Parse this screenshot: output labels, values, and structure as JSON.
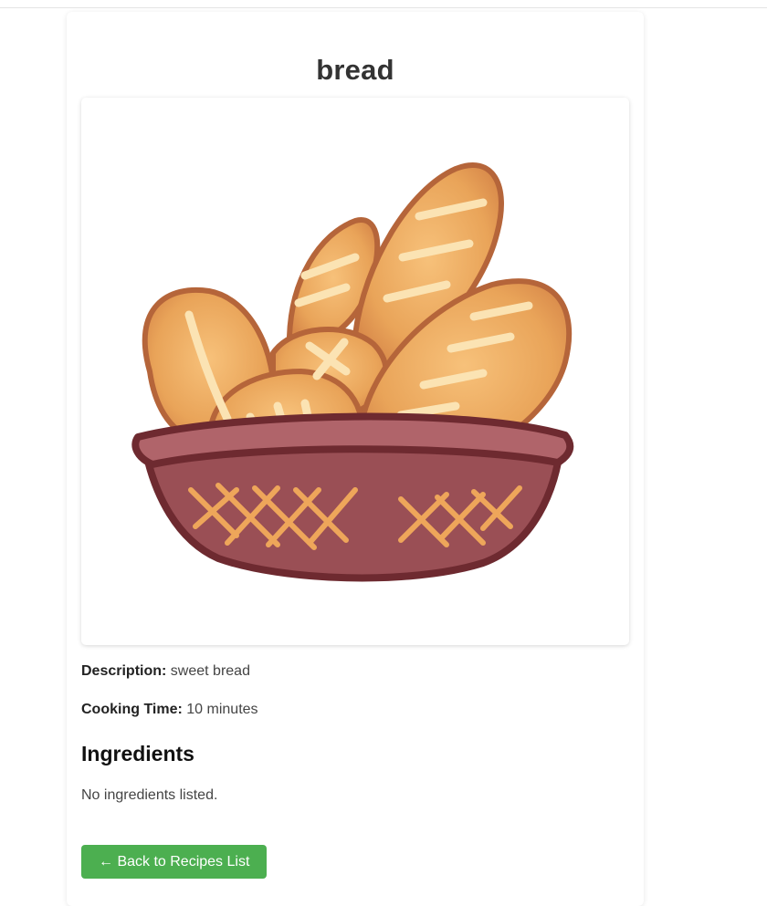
{
  "recipe": {
    "title": "bread",
    "image_alt": "Basket of bread illustration",
    "description_label": "Description:",
    "description": "sweet bread",
    "cooking_time_label": "Cooking Time:",
    "cooking_time": "10 minutes"
  },
  "ingredients": {
    "heading": "Ingredients",
    "empty_text": "No ingredients listed."
  },
  "navigation": {
    "back_label": "← Back to Recipes List"
  },
  "colors": {
    "button_bg": "#4caf50",
    "title_text": "#333333",
    "bread_crust": "#e39a4d",
    "bread_outline": "#b5653a",
    "basket_fill": "#9a4f55",
    "basket_outline": "#6e2a30",
    "weave": "#eea65a"
  }
}
